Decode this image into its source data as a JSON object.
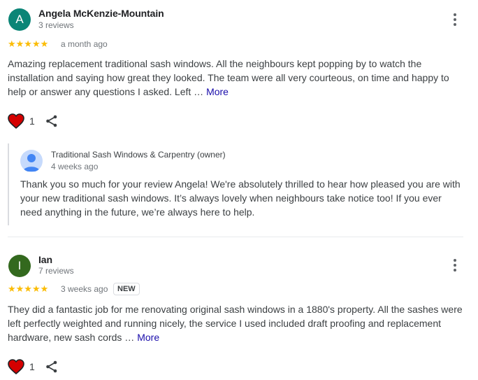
{
  "reviews": [
    {
      "avatar_letter": "A",
      "avatar_color": "#0b8577",
      "name": "Angela McKenzie-Mountain",
      "review_count": "3 reviews",
      "rating": 5,
      "stars": "★★★★★",
      "date": "a month ago",
      "text": "Amazing replacement traditional sash windows. All the neighbours kept popping by to watch the installation and saying how great they looked. The team were all very courteous, on time and happy to help or answer any questions I asked. Left …",
      "more_label": "More",
      "likes": "1",
      "reply": {
        "owner": "Traditional Sash Windows & Carpentry (owner)",
        "date": "4 weeks ago",
        "text": "Thank you so much for your review Angela! We're absolutely thrilled to hear how pleased you are with your new traditional sash windows. It’s always lovely when neighbours take notice too! If you ever need anything in the future, we’re always here to help."
      }
    },
    {
      "avatar_letter": "I",
      "avatar_color": "#33691e",
      "name": "Ian",
      "review_count": "7 reviews",
      "rating": 5,
      "stars": "★★★★★",
      "date": "3 weeks ago",
      "badge": "NEW",
      "text": "They did a fantastic job for me renovating original sash windows in a 1880's property. All the sashes were left perfectly weighted and running nicely, the service I used included draft proofing and replacement hardware, new sash cords …",
      "more_label": "More",
      "likes": "1"
    }
  ],
  "colors": {
    "star": "#fbbc04",
    "heart": "#d50000",
    "link": "#1a0dab",
    "owner_avatar": "#7baaf7"
  }
}
